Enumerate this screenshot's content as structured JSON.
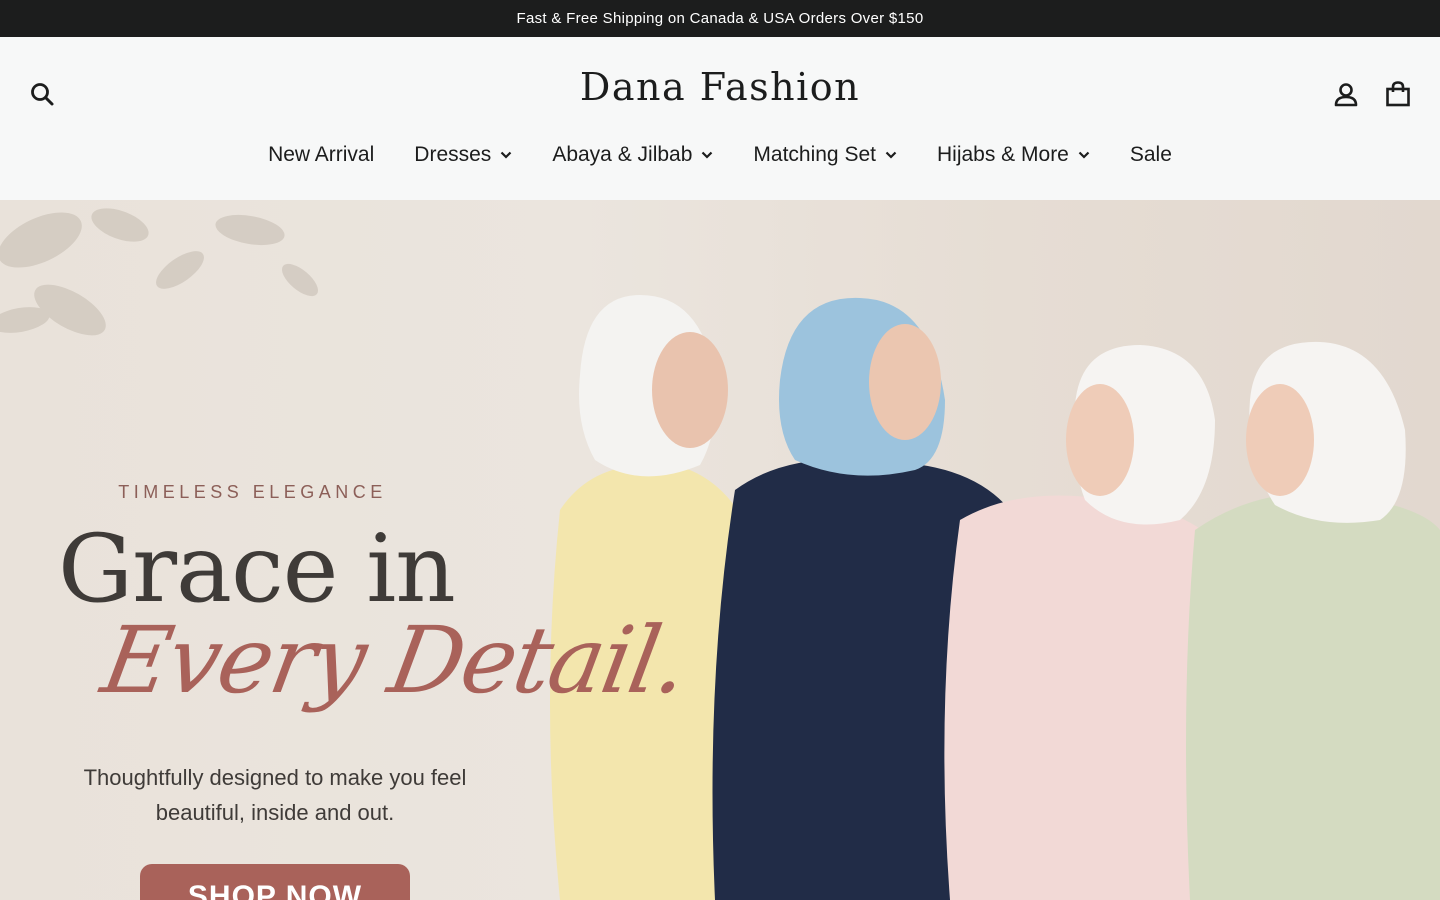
{
  "announcement": "Fast & Free Shipping on Canada & USA Orders Over $150",
  "header": {
    "logo": "Dana Fashion",
    "icons": {
      "search": "search-icon",
      "account": "user-icon",
      "cart": "shopping-bag-icon"
    }
  },
  "nav": {
    "items": [
      {
        "label": "New Arrival",
        "has_dropdown": false
      },
      {
        "label": "Dresses",
        "has_dropdown": true
      },
      {
        "label": "Abaya & Jilbab",
        "has_dropdown": true
      },
      {
        "label": "Matching Set",
        "has_dropdown": true
      },
      {
        "label": "Hijabs & More",
        "has_dropdown": true
      },
      {
        "label": "Sale",
        "has_dropdown": false
      }
    ]
  },
  "hero": {
    "eyebrow": "TIMELESS ELEGANCE",
    "headline": "Grace in",
    "script_line": "Every Detail.",
    "tagline_line1": "Thoughtfully designed to make you feel",
    "tagline_line2": "beautiful, inside and out.",
    "button": "SHOP NOW",
    "colors": {
      "accent": "#a9625a",
      "eyebrow": "#8c5f58",
      "text": "#3f3b38"
    }
  }
}
